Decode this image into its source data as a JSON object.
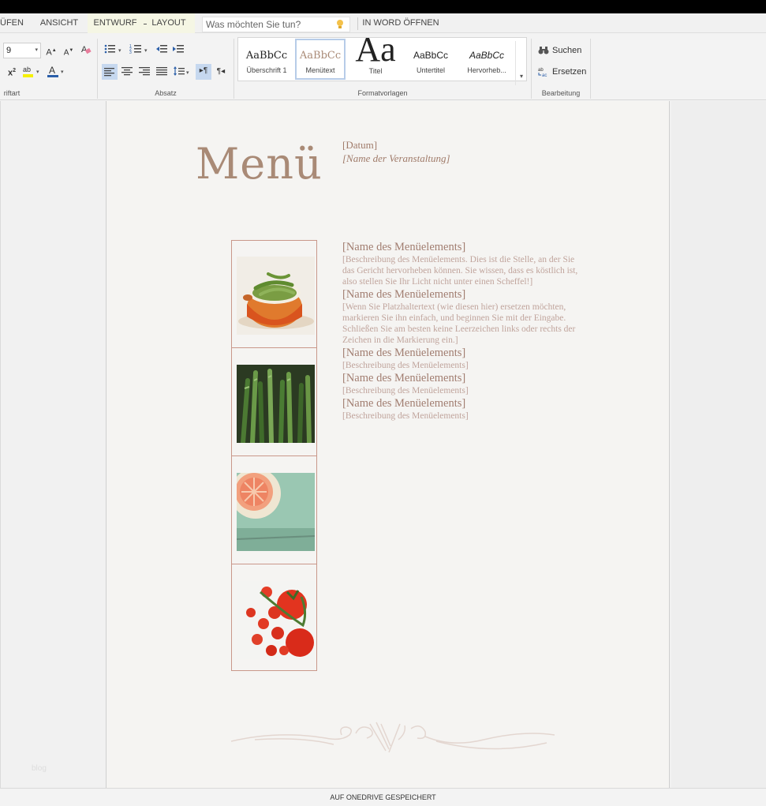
{
  "tabs": {
    "items": [
      {
        "label": "ÜFEN"
      },
      {
        "label": "ANSICHT"
      },
      {
        "label": "ENTWURF"
      },
      {
        "label": "LAYOUT"
      }
    ],
    "search_placeholder": "Was möchten Sie tun?",
    "open_in_word": "IN WORD ÖFFNEN"
  },
  "ribbon": {
    "font": {
      "size_value": "9",
      "group_label": "riftart"
    },
    "paragraph": {
      "group_label": "Absatz"
    },
    "styles": {
      "group_label": "Formatvorlagen",
      "items": [
        {
          "preview": "AaBbCc",
          "label": "Überschrift 1"
        },
        {
          "preview": "AaBbCc",
          "label": "Menütext"
        },
        {
          "preview": "Aa",
          "label": "Titel"
        },
        {
          "preview": "AaBbCc",
          "label": "Untertitel"
        },
        {
          "preview": "AaBbCc",
          "label": "Hervorheb..."
        }
      ]
    },
    "editing": {
      "group_label": "Bearbeitung",
      "search_label": "Suchen",
      "replace_label": "Ersetzen"
    }
  },
  "document": {
    "title": "Menü",
    "date": "[Datum]",
    "event": "[Name der Veranstaltung]",
    "items": [
      {
        "name": "[Name des Menüelements]",
        "desc": "[Beschreibung des Menüelements. Dies ist die Stelle, an der Sie das Gericht hervorheben können. Sie wissen, dass es köstlich ist, also stellen Sie Ihr Licht nicht unter einen Scheffel!]"
      },
      {
        "name": "[Name des Menüelements]",
        "desc": "[Wenn Sie Platzhaltertext (wie diesen hier) ersetzen möchten, markieren Sie ihn einfach, und beginnen Sie mit der Eingabe. Schließen Sie am besten keine Leerzeichen links oder rechts der Zeichen in die Markierung ein.]"
      },
      {
        "name": "[Name des Menüelements]",
        "desc": "[Beschreibung des Menüelements]"
      },
      {
        "name": "[Name des Menüelements]",
        "desc": "[Beschreibung des Menüelements]"
      },
      {
        "name": "[Name des Menüelements]",
        "desc": "[Beschreibung des Menüelements]"
      }
    ],
    "photos": [
      "green-beans-photo",
      "asparagus-photo",
      "grapefruit-photo",
      "tomatoes-photo"
    ],
    "watermark": "blog"
  },
  "statusbar": {
    "text": "AUF ONEDRIVE GESPEICHERT"
  },
  "colors": {
    "accent": "#a98a76",
    "item_name": "#a17d70",
    "item_desc": "#c0a49c",
    "rule": "#c9988a"
  }
}
